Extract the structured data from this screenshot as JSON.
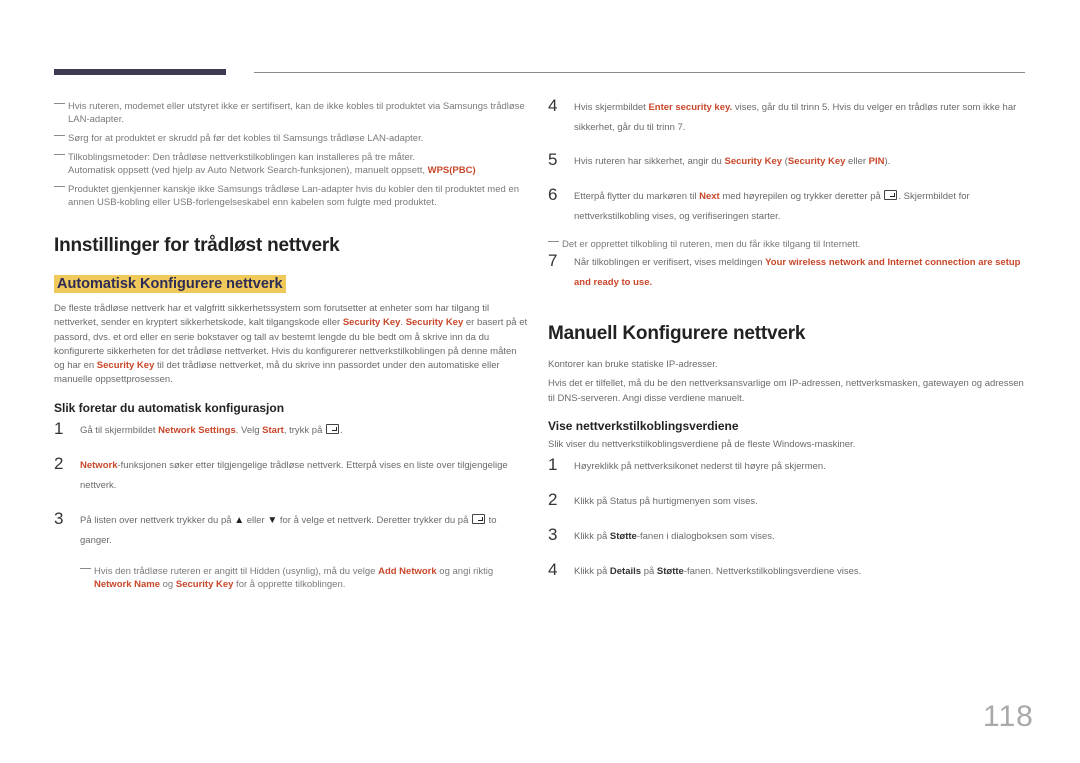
{
  "notes_top": [
    "Hvis ruteren, modemet eller utstyret ikke er sertifisert, kan de ikke kobles til produktet via Samsungs trådløse LAN-adapter.",
    "Sørg for at produktet er skrudd på før det kobles til Samsungs trådløse LAN-adapter.",
    {
      "text": "Tilkoblingsmetoder: Den trådløse nettverkstilkoblingen kan installeres på tre måter.",
      "line2": "Automatisk oppsett (ved hjelp av Auto Network Search-funksjonen), manuelt oppsett, ",
      "highlight": "WPS(PBC)"
    },
    "Produktet gjenkjenner kanskje ikke Samsungs trådløse Lan-adapter hvis du kobler den til produktet med en annen USB-kobling eller USB-forlengelseskabel enn kabelen som fulgte med produktet."
  ],
  "section_title": "Innstillinger for trådløst nettverk",
  "subsection_auto": "Automatisk Konfigurere nettverk",
  "auto_para": {
    "p1": "De fleste trådløse nettverk har et valgfritt sikkerhetssystem som forutsetter at enheter som har tilgang til nettverket, sender en kryptert sikkerhetskode, kalt tilgangskode eller ",
    "k1": "Security Key",
    "p2": ". ",
    "k2": "Security Key",
    "p3": " er basert på et passord, dvs. et ord eller en serie bokstaver og tall av bestemt lengde du ble bedt om å skrive inn da du konfigurerte sikkerheten for det trådløse nettverket. Hvis du konfigurerer nettverkstilkoblingen på denne måten og har en ",
    "k3": "Security Key",
    "p4": " til det trådløse nettverket, må du skrive inn passordet under den automatiske eller manuelle oppsettprosessen."
  },
  "auto_steps_title": "Slik foretar du automatisk konfigurasjon",
  "auto_steps": [
    {
      "num": "1",
      "a": "Gå til skjermbildet ",
      "b": "Network Settings",
      "c": ". Velg ",
      "d": "Start",
      "e": ", trykk på ",
      "f": "."
    },
    {
      "num": "2",
      "b": "Network",
      "c": "-funksjonen søker etter tilgjengelige trådløse nettverk. Etterpå vises en liste over tilgjengelige nettverk."
    },
    {
      "num": "3",
      "a": "På listen over nettverk trykker du på ",
      "up": "▲",
      "b": " eller ",
      "down": "▼",
      "c": " for å velge et nettverk. Deretter trykker du på ",
      "d": " to ganger."
    }
  ],
  "hidden_note": {
    "a": "Hvis den trådløse ruteren er angitt til Hidden (usynlig), må du velge ",
    "b": "Add Network",
    "c": " og angi riktig ",
    "d": "Network Name",
    "e": " og ",
    "f": "Security Key",
    "g": " for å opprette tilkoblingen."
  },
  "right_steps": [
    {
      "num": "4",
      "a": "Hvis skjermbildet ",
      "b": "Enter security key.",
      "c": " vises, går du til trinn 5. Hvis du velger en trådløs ruter som ikke har sikkerhet, går du til trinn 7."
    },
    {
      "num": "5",
      "a": "Hvis ruteren har sikkerhet, angir du ",
      "b": "Security Key",
      "c": " (",
      "d": "Security Key",
      "e": " eller ",
      "f": "PIN",
      "g": ")."
    },
    {
      "num": "6",
      "a": "Etterpå flytter du markøren til ",
      "b": "Next",
      "c": " med høyrepilen og trykker deretter på ",
      "d": ". Skjermbildet for nettverkstilkobling vises, og verifiseringen starter."
    }
  ],
  "internet_note": "Det er opprettet tilkobling til ruteren, men du får ikke tilgang til Internett.",
  "step7": {
    "num": "7",
    "a": "Når tilkoblingen er verifisert, vises meldingen ",
    "b": "Your wireless network and Internet connection are setup and ready to use."
  },
  "manual_title": "Manuell Konfigurere nettverk",
  "manual_p1": "Kontorer kan bruke statiske IP-adresser.",
  "manual_p2": "Hvis det er tilfellet, må du be den nettverksansvarlige om IP-adressen, nettverksmasken, gatewayen og adressen til DNS-serveren. Angi disse verdiene manuelt.",
  "view_title": "Vise nettverkstilkoblingsverdiene",
  "view_intro": "Slik viser du nettverkstilkoblingsverdiene på de fleste Windows-maskiner.",
  "view_steps": [
    {
      "num": "1",
      "a": "Høyreklikk på nettverksikonet nederst til høyre på skjermen."
    },
    {
      "num": "2",
      "a": "Klikk på Status på hurtigmenyen som vises."
    },
    {
      "num": "3",
      "a": "Klikk på ",
      "b": "Støtte",
      "c": "-fanen i dialogboksen som vises."
    },
    {
      "num": "4",
      "a": "Klikk på ",
      "b": "Details",
      "c": " på ",
      "d": "Støtte",
      "e": "-fanen. Nettverkstilkoblingsverdiene vises."
    }
  ],
  "page_number": "118",
  "colors": {
    "accent_red": "#c9472a",
    "highlight": "#efc95a",
    "header_bar": "#3f3a52"
  }
}
